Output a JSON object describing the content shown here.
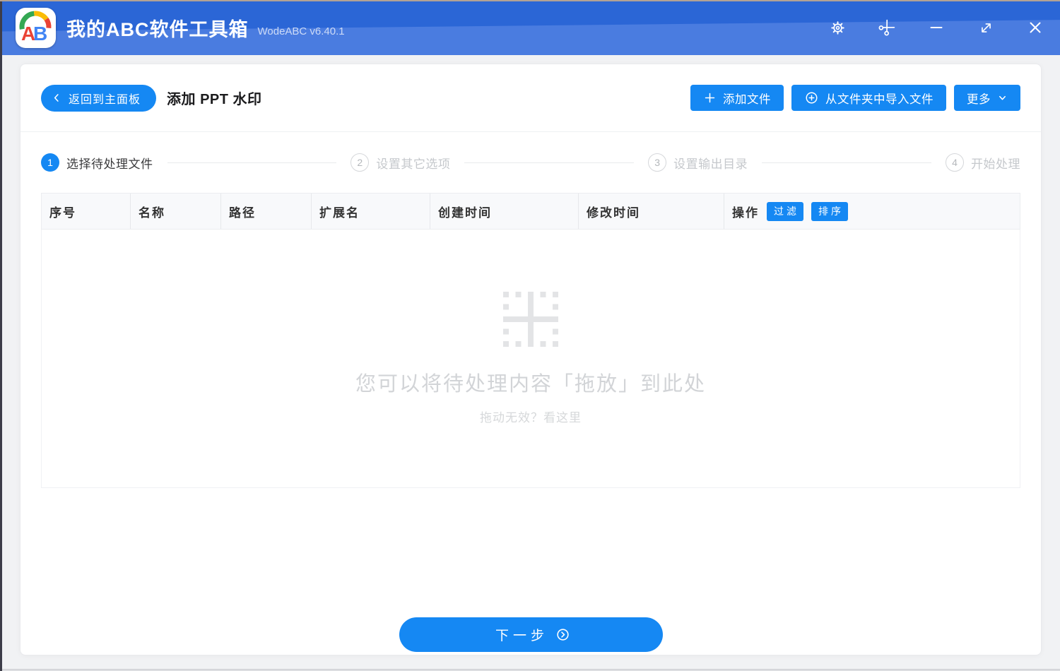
{
  "titlebar": {
    "app_name": "我的ABC软件工具箱",
    "version": "WodeABC v6.40.1",
    "logo": {
      "letter_a": "A",
      "letter_b": "B"
    },
    "window_icons": {
      "settings": "gear",
      "snip": "scissors",
      "minimize": "minus",
      "resize": "diagonal-resize-arrow",
      "close": "x"
    }
  },
  "toolbar": {
    "back_label": "返回到主面板",
    "page_title": "添加 PPT 水印",
    "add_files_label": "添加文件",
    "import_folder_label": "从文件夹中导入文件",
    "more_label": "更多"
  },
  "steps": [
    {
      "number": "1",
      "label": "选择待处理文件",
      "state": "active"
    },
    {
      "number": "2",
      "label": "设置其它选项",
      "state": "pending"
    },
    {
      "number": "3",
      "label": "设置输出目录",
      "state": "pending"
    },
    {
      "number": "4",
      "label": "开始处理",
      "state": "pending"
    }
  ],
  "table": {
    "columns": [
      "序号",
      "名称",
      "路径",
      "扩展名",
      "创建时间",
      "修改时间",
      "操作"
    ],
    "actions": {
      "filter_label": "过滤",
      "sort_label": "排序"
    },
    "rows": []
  },
  "empty_state": {
    "icon": "dotted-square-plus",
    "main_text": "您可以将待处理内容「拖放」到此处",
    "sub_text": "拖动无效？看这里"
  },
  "footer": {
    "next_label": "下一步"
  },
  "colors": {
    "accent": "#1588f3",
    "titlebar_top": "#2b66d6",
    "titlebar_bottom": "#4a7ce0",
    "card_bg": "#ffffff",
    "window_bg": "#f1f2f4",
    "muted_text": "#d2d4d7"
  }
}
